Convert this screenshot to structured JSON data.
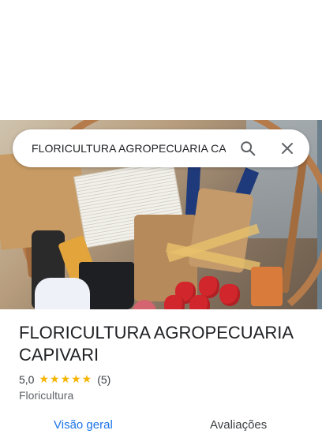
{
  "search": {
    "query": "FLORICULTURA AGROPECUARIA CAPIVARI"
  },
  "icons": {
    "search": "search-icon",
    "close": "close-icon",
    "star": "star-icon"
  },
  "place": {
    "name": "FLORICULTURA AGROPECUARIA CAPIVARI",
    "rating": "5,0",
    "stars": "★★★★★",
    "review_count": "(5)",
    "category": "Floricultura"
  },
  "tabs": [
    {
      "label": "Visão geral",
      "active": true
    },
    {
      "label": "Avaliações",
      "active": false
    }
  ],
  "colors": {
    "accent": "#1a73e8",
    "star": "#f4b400"
  }
}
